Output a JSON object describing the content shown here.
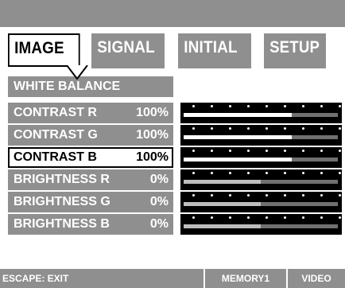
{
  "tabs": [
    {
      "label": "IMAGE",
      "active": true
    },
    {
      "label": "SIGNAL",
      "active": false
    },
    {
      "label": "INITIAL",
      "active": false
    },
    {
      "label": "SETUP",
      "active": false
    }
  ],
  "menu": {
    "section_title": "WHITE BALANCE",
    "rows": [
      {
        "label": "CONTRAST R",
        "value": "100%",
        "level": 0.7,
        "selected": false
      },
      {
        "label": "CONTRAST G",
        "value": "100%",
        "level": 0.7,
        "selected": false
      },
      {
        "label": "CONTRAST B",
        "value": "100%",
        "level": 0.7,
        "selected": true
      },
      {
        "label": "BRIGHTNESS R",
        "value": "0%",
        "level": 0.5,
        "selected": false
      },
      {
        "label": "BRIGHTNESS G",
        "value": "0%",
        "level": 0.5,
        "selected": false
      },
      {
        "label": "BRIGHTNESS B",
        "value": "0%",
        "level": 0.5,
        "selected": false
      }
    ]
  },
  "status": {
    "escape": "ESCAPE: EXIT",
    "memory": "MEMORY1",
    "video": "VIDEO"
  },
  "colors": {
    "background": "#ffffff",
    "panel_gray": "#8f8f8f",
    "selected_text": "#000000",
    "slider_background": "#000000",
    "slider_active_fill": "#ffffff"
  },
  "icons": {
    "tab_pointer": "tab-pointer-icon",
    "slider_dots": "scale-dot-icon"
  }
}
